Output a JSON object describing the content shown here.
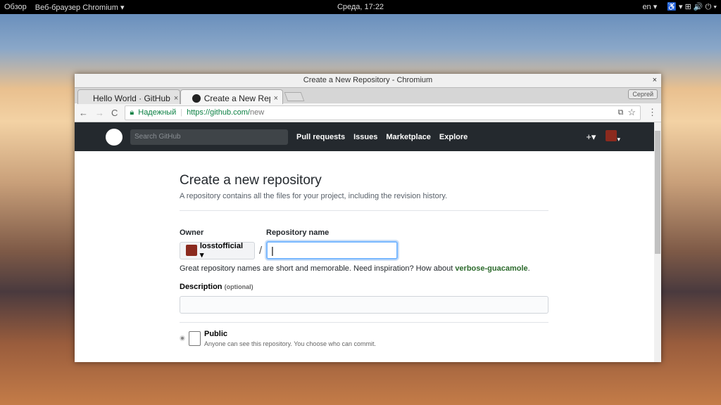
{
  "topbar": {
    "activities": "Обзор",
    "app": "Веб-браузер Chromium ▾",
    "clock": "Среда, 17:22",
    "lang": "en ▾",
    "indicators": "♿ ▾  ⊞ 🔊 ⏻ ▾"
  },
  "window": {
    "title": "Create a New Repository - Chromium",
    "close": "×",
    "user": "Сергей"
  },
  "tabs": [
    {
      "label": "Hello World · GitHub",
      "close": "×"
    },
    {
      "label": "Create a New Repository",
      "close": "×"
    }
  ],
  "toolbar": {
    "back": "←",
    "forward": "→",
    "reload": "C",
    "secure": "Надежный",
    "url_host": "https://github.com/",
    "url_path": "new",
    "translate": "⧉",
    "star": "☆",
    "menu": "⋮"
  },
  "github": {
    "search_placeholder": "Search GitHub",
    "nav": [
      "Pull requests",
      "Issues",
      "Marketplace",
      "Explore"
    ],
    "plus": "+▾",
    "avatar_caret": "▾"
  },
  "form": {
    "title": "Create a new repository",
    "subtitle": "A repository contains all the files for your project, including the revision history.",
    "owner_label": "Owner",
    "repo_label": "Repository name",
    "owner": "losstofficial ▾",
    "slash": "/",
    "repo_value": "|",
    "hint": "Great repository names are short and memorable. Need inspiration? How about ",
    "suggestion": "verbose-guacamole",
    "hint_end": ".",
    "desc_label": "Description",
    "desc_optional": "(optional)",
    "public_label": "Public",
    "public_desc": "Anyone can see this repository. You choose who can commit."
  }
}
